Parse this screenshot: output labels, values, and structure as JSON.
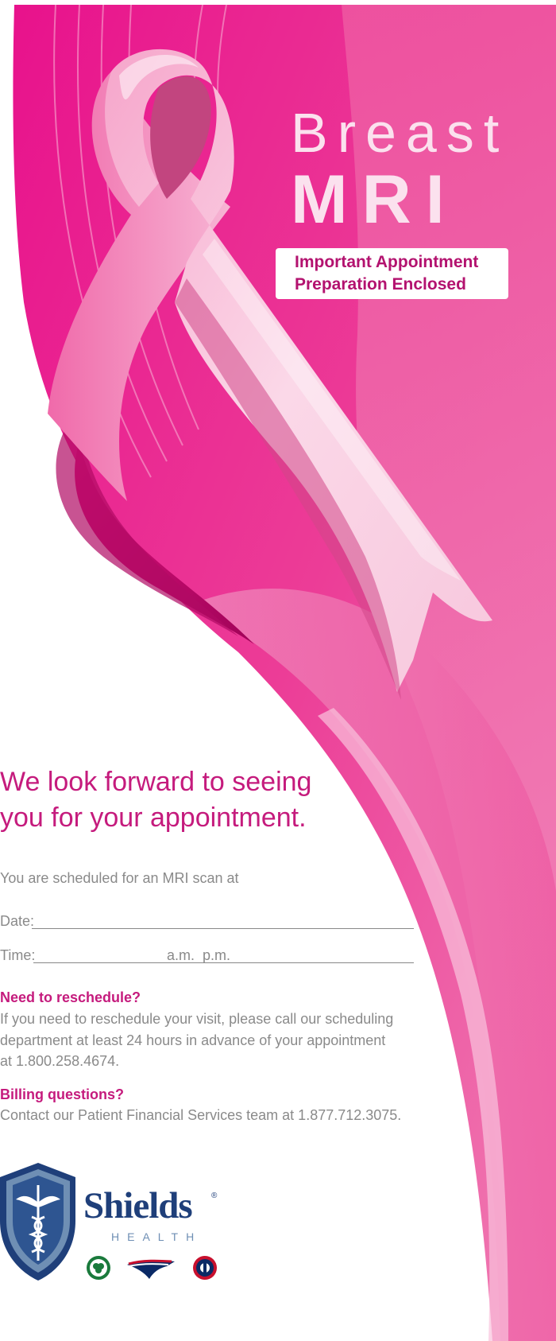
{
  "cover": {
    "title_line1": "Breast",
    "title_line2": "MRI",
    "notice_line1": "Important Appointment",
    "notice_line2": "Preparation Enclosed"
  },
  "appointment": {
    "headline_line1": "We look forward to seeing",
    "headline_line2": "you for your appointment.",
    "intro": "You are scheduled for an MRI scan at",
    "date_label": "Date:",
    "time_label": "Time:",
    "time_am": "a.m.",
    "time_pm": "p.m."
  },
  "reschedule": {
    "heading": "Need to reschedule?",
    "line1": "If you need to reschedule your visit, please call our scheduling",
    "line2": "department at least 24 hours in advance of your appointment",
    "line3": "at 1.800.258.4674."
  },
  "billing": {
    "heading": "Billing questions?",
    "line1": "Contact our Patient Financial Services team at 1.877.712.3075."
  },
  "brand": {
    "name": "Shields",
    "subname": "HEALTH",
    "registered": "®",
    "partner_logos": [
      "celtics-logo",
      "patriots-logo",
      "revolution-logo"
    ],
    "colors": {
      "primary_pink": "#e91e8c",
      "deep_pink": "#c51b7d",
      "navy": "#1f3f7a",
      "light_blue": "#6f8fb4"
    }
  }
}
